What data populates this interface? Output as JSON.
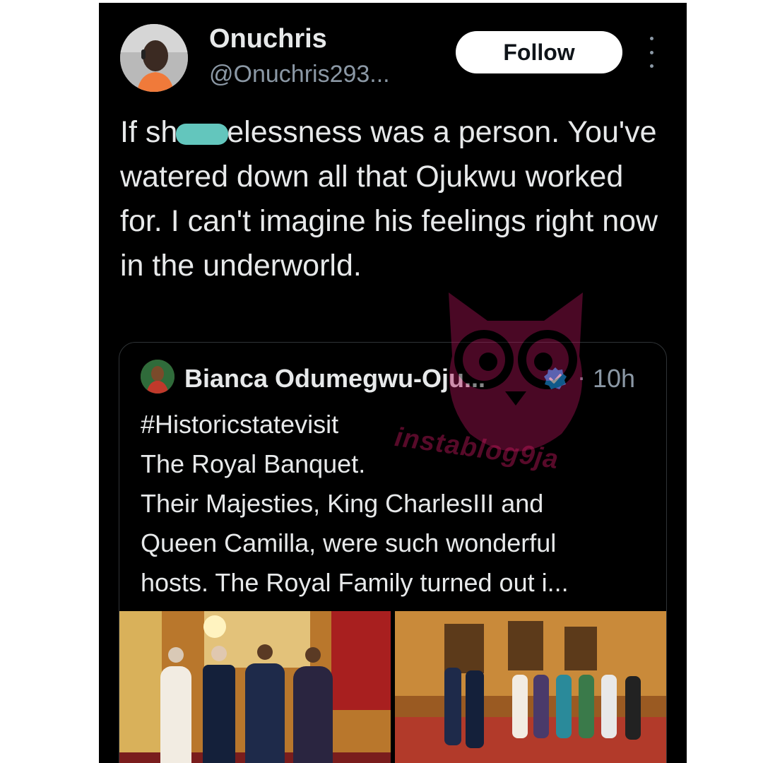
{
  "post": {
    "author_name": "Onuchris",
    "author_handle": "@Onuchris293...",
    "follow_label": "Follow",
    "text_line1_prefix": "If sh",
    "text_line1_suffix": "elessness was a person.",
    "text_rest": "You've watered down all that Ojukwu worked for. I can't imagine his feelings right now in the underworld."
  },
  "quote": {
    "author_name": "Bianca Odumegwu-Oju...",
    "separator": "·",
    "time": "10h",
    "lines": [
      "#Historicstatevisit",
      "The Royal Banquet.",
      "Their Majesties,  King CharlesIII and",
      "Queen Camilla, were such wonderful",
      "hosts. The Royal Family turned out i..."
    ]
  },
  "watermark": {
    "text": "instablog9ja"
  },
  "colors": {
    "background": "#000000",
    "text": "#e7e9ea",
    "muted": "#8b98a5",
    "verified": "#1d9bf0",
    "censor": "#63c6bd",
    "watermark": "#c2185b"
  },
  "icons": {
    "more": "more-vertical-icon",
    "verified": "verified-badge-icon"
  }
}
